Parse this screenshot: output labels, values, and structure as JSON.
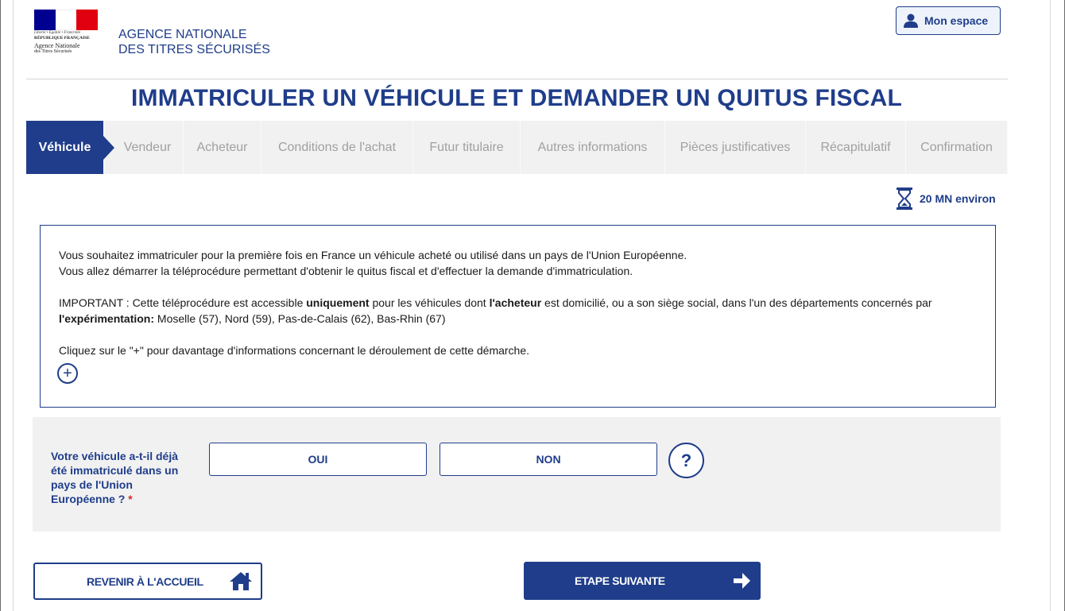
{
  "header": {
    "logo": {
      "motto": "Liberté • Égalité • Fraternité",
      "republic": "RÉPUBLIQUE FRANÇAISE",
      "agency_line1": "Agence Nationale",
      "agency_line2": "des Titres Sécurisés",
      "flag_colors": [
        "#000091",
        "#ffffff",
        "#e1000f"
      ]
    },
    "agency_line1": "AGENCE NATIONALE",
    "agency_line2": "DES TITRES SÉCURISÉS",
    "my_space_label": "Mon espace",
    "my_space_icon": "user-icon"
  },
  "page_title": "IMMATRICULER UN VÉHICULE ET DEMANDER UN QUITUS FISCAL",
  "steps": [
    {
      "label": "Véhicule",
      "active": true
    },
    {
      "label": "Vendeur",
      "active": false
    },
    {
      "label": "Acheteur",
      "active": false
    },
    {
      "label": "Conditions de l'achat",
      "active": false
    },
    {
      "label": "Futur titulaire",
      "active": false
    },
    {
      "label": "Autres informations",
      "active": false
    },
    {
      "label": "Pièces justificatives",
      "active": false
    },
    {
      "label": "Récapitulatif",
      "active": false
    },
    {
      "label": "Confirmation",
      "active": false
    }
  ],
  "duration": {
    "label": "20 MN environ",
    "icon": "hourglass-icon"
  },
  "info": {
    "line1": "Vous souhaitez immatriculer pour la première fois en France un véhicule acheté ou utilisé dans un pays de l'Union Européenne.",
    "line2": "Vous allez démarrer la téléprocédure permettant d'obtenir le quitus fiscal et d'effectuer la demande d'immatriculation.",
    "important_a": "IMPORTANT : Cette téléprocédure est accessible ",
    "important_b": "uniquement",
    "important_c": " pour les véhicules dont ",
    "important_d": "l'acheteur",
    "important_e": " est domicilié, ou a son siège social, dans l'un des départements concernés par",
    "important_f": "l'expérimentation:",
    "important_g": " Moselle (57), Nord (59), Pas-de-Calais (62), Bas-Rhin (67)",
    "more_hint": "Cliquez sur le \"+\" pour davantage d'informations concernant le déroulement de cette démarche.",
    "expand_label": "+"
  },
  "question": {
    "label": "Votre véhicule a-t-il déjà été immatriculé dans un pays de l'Union Européenne ?",
    "required_mark": "*",
    "yes_label": "OUI",
    "no_label": "NON",
    "help_label": "?"
  },
  "footer": {
    "back_label": "REVENIR À L'ACCUEIL",
    "back_icon": "home-icon",
    "next_label": "ETAPE SUIVANTE",
    "next_icon": "arrow-right-icon"
  },
  "colors": {
    "primary": "#1f3d8a",
    "step_bg": "#f1f1f1",
    "step_inactive_text": "#a0a0a0",
    "required": "#d42a2a"
  }
}
